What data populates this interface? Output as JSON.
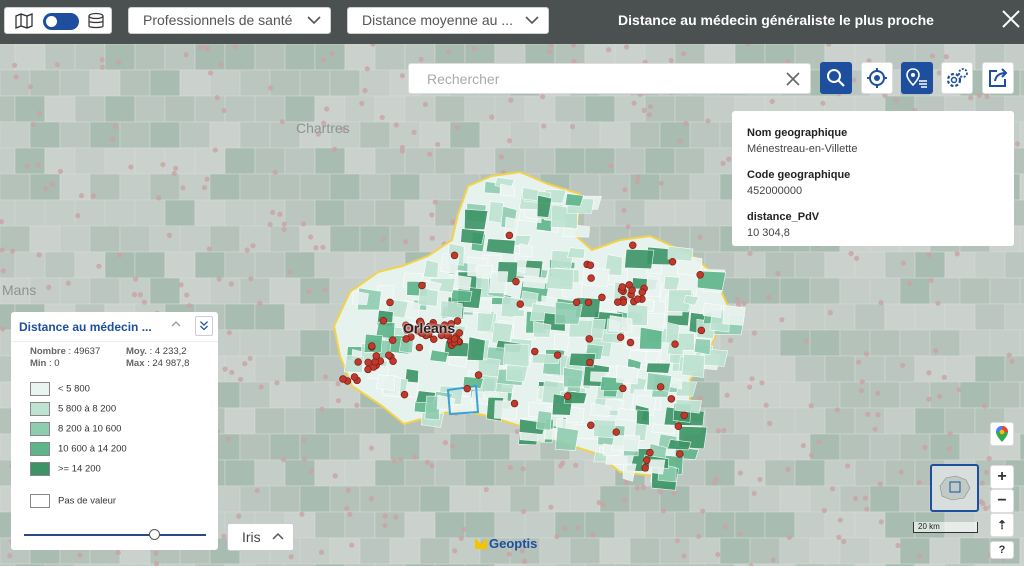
{
  "header": {
    "theme_dropdown": "Professionnels de santé",
    "indicator_dropdown": "Distance moyenne au ...",
    "title": "Distance au médecin généraliste le plus proche"
  },
  "map": {
    "place_labels": [
      "Chartres",
      "Mans",
      "Orléans"
    ],
    "branding": "Geoptis",
    "scale_label": "20 km"
  },
  "search": {
    "placeholder": "Rechercher"
  },
  "tools": [
    "search-icon",
    "locate-icon",
    "poi-list-icon",
    "settings-icon",
    "share-icon"
  ],
  "info_panel": [
    {
      "key": "Nom geographique",
      "value": "Ménestreau-en-Villette"
    },
    {
      "key": "Code geographique",
      "value": "452000000"
    },
    {
      "key": "distance_PdV",
      "value": "10 304,8"
    }
  ],
  "legend": {
    "title": "Distance au médecin ...",
    "stats": {
      "nombre_label": "Nombre",
      "nombre": ": 49637",
      "min_label": "Min",
      "min": ": 0",
      "moy_label": "Moy.",
      "moy": ": 4 233,2",
      "max_label": "Max",
      "max": ": 24 987,8"
    },
    "classes": [
      {
        "label": "< 5 800",
        "color": "#eaf4f0"
      },
      {
        "label": "5 800 à 8 200",
        "color": "#bfe3d3"
      },
      {
        "label": "8 200 à 10 600",
        "color": "#8fcdb1"
      },
      {
        "label": "10 600 à 14 200",
        "color": "#5db58a"
      },
      {
        "label": ">= 14 200",
        "color": "#3c9466"
      }
    ],
    "no_value": {
      "label": "Pas de valeur",
      "color": "#ffffff"
    },
    "opacity": 0.75
  },
  "level_selector": {
    "value": "Iris"
  },
  "controls": {
    "zoom_in": "+",
    "zoom_out": "−",
    "north": "⇡",
    "help": "?"
  },
  "colors": {
    "accent": "#1d4f9e",
    "topbar": "#4b5050",
    "point": "#c0392b",
    "boundary": "#f2d24b"
  }
}
